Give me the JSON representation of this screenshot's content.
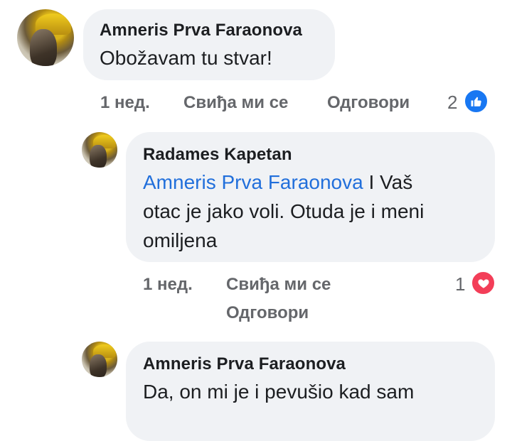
{
  "colors": {
    "bubble": "#f0f2f5",
    "name": "#1c1e21",
    "meta": "#65676b",
    "mention": "#216fdb",
    "like": "#1877f2",
    "love": "#f33e58"
  },
  "comments": [
    {
      "author": "Amneris Prva Faraonova",
      "text": "Obožavam tu stvar!",
      "time": "1 нед.",
      "like_label": "Свиђа ми се",
      "reply_label": "Одговори",
      "reaction_count": "2",
      "reaction_icon": "like-icon"
    },
    {
      "author": "Radames Kapetan",
      "mention": "Amneris Prva Faraonova",
      "text_line1": " I Vaš",
      "text_line2": "otac je jako voli. Otuda je i meni",
      "text_line3": "omiljena",
      "time": "1 нед.",
      "like_label": "Свиђа ми се",
      "reply_label": "Одговори",
      "reaction_count": "1",
      "reaction_icon": "love-icon"
    },
    {
      "author": "Amneris Prva Faraonova",
      "text": "Da, on mi je i pevušio kad sam"
    }
  ]
}
